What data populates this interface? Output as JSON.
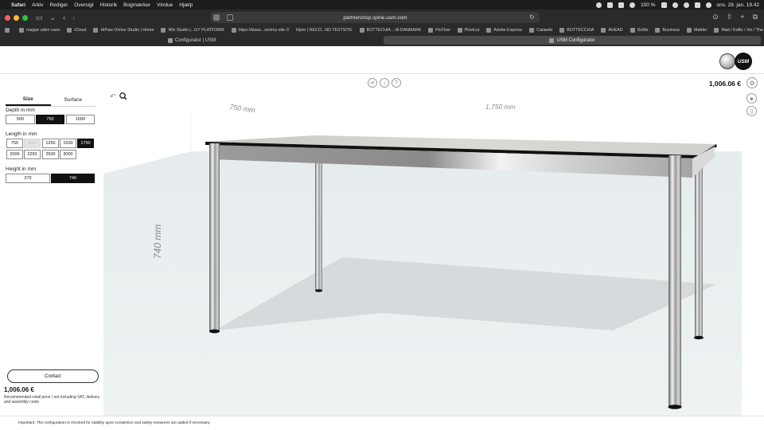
{
  "menubar": {
    "apple_icon": "apple-icon",
    "items": [
      "Safari",
      "Arkiv",
      "Rediger",
      "Oversigt",
      "Historik",
      "Bogmærker",
      "Vindue",
      "Hjælp"
    ],
    "battery": "100 %",
    "clock": "ons. 28. jan.  19.42"
  },
  "browser": {
    "address": "partnershop.spine.usm.com",
    "bookmarks": [
      "mappe uden navn",
      "iCloud",
      "HiPaw Online Studio | Home",
      "Wix Studio |...GY PLATFORM",
      "https://klaus...om/my-site-3",
      "Hjem | RECO...ND TESTSITE",
      "BOTTECHIA ...IA DANMARK",
      "PicFlow",
      "Pixelcut",
      "Adobe Express",
      "Catawiki",
      "BOTTECCHIA",
      "AHEAD",
      "SoMe",
      "Business",
      "Møbler",
      "Mad / Kaffe / Vin / The"
    ],
    "tabs": [
      {
        "label": "Configurator | USM",
        "active": false
      },
      {
        "label": "USM Configurator",
        "active": true
      }
    ]
  },
  "header": {
    "logo_text": "USM",
    "price": "1,006.06 €"
  },
  "sidebar": {
    "tabs": [
      {
        "label": "Size",
        "active": true
      },
      {
        "label": "Surface",
        "active": false
      }
    ],
    "depth": {
      "label": "Depth in mm",
      "options": [
        {
          "label": "500",
          "state": "normal"
        },
        {
          "label": "750",
          "state": "selected"
        },
        {
          "label": "1000",
          "state": "normal"
        }
      ]
    },
    "length": {
      "label": "Length in mm",
      "options": [
        {
          "label": "750",
          "state": "normal"
        },
        {
          "label": "1000",
          "state": "disabled"
        },
        {
          "label": "1250",
          "state": "normal"
        },
        {
          "label": "1500",
          "state": "normal"
        },
        {
          "label": "1750",
          "state": "selected"
        },
        {
          "label": "2000",
          "state": "normal"
        },
        {
          "label": "2250",
          "state": "normal"
        },
        {
          "label": "2500",
          "state": "normal"
        },
        {
          "label": "3000",
          "state": "normal"
        }
      ]
    },
    "height": {
      "label": "Height in mm",
      "options": [
        {
          "label": "370",
          "state": "normal"
        },
        {
          "label": "740",
          "state": "selected"
        }
      ]
    },
    "contact_label": "Contact",
    "price": "1,006.06 €",
    "price_note": "Recommended retail price / not including VAT, delivery and assembly costs"
  },
  "viewer": {
    "dim_depth": "750 mm",
    "dim_length": "1,750 mm",
    "dim_height": "740 mm"
  },
  "footer": {
    "note": "Important: The configuration is checked for stability upon completion and safety measures are added if necessary."
  },
  "colors": {
    "selected": "#111111",
    "disabled": "#e4e4e4",
    "floor": "#e9eef0",
    "chrome": "#9a9a9a"
  }
}
